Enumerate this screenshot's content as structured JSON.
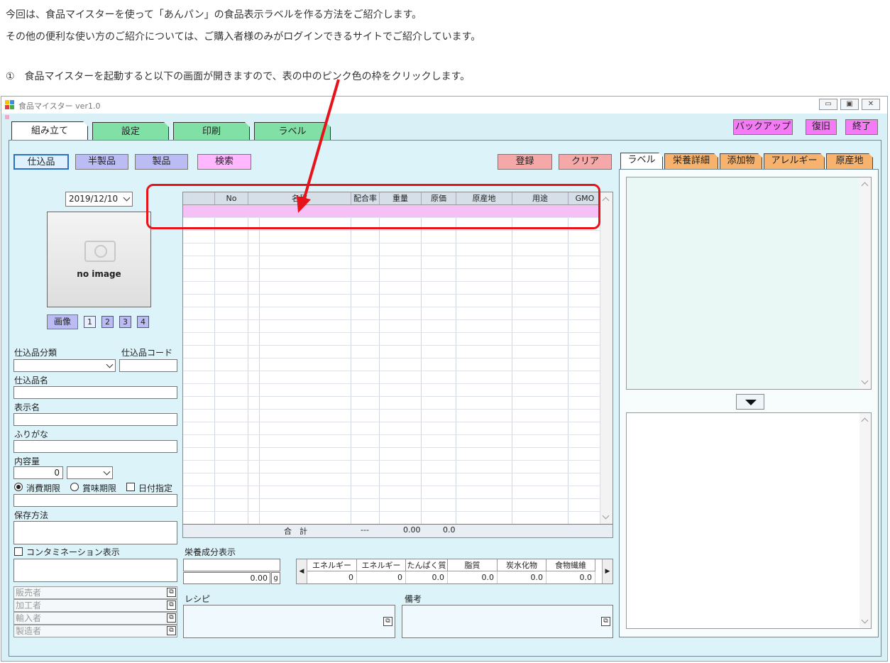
{
  "intro": {
    "line1": "今回は、食品マイスターを使って「あんパン」の食品表示ラベルを作る方法をご紹介します。",
    "line2": "その他の便利な使い方のご紹介については、ご購入者様のみがログインできるサイトでご紹介しています。",
    "step1": "①　食品マイスターを起動すると以下の画面が開きますので、表の中のピンク色の枠をクリックします。"
  },
  "window": {
    "title": "食品マイスター ver1.0",
    "minimize": "▭",
    "maximize": "▣",
    "close": "✕"
  },
  "main_tabs": [
    "組み立て",
    "設定",
    "印刷",
    "ラベル"
  ],
  "top_right_buttons": [
    "バックアップ",
    "復旧",
    "終了"
  ],
  "type_buttons": [
    "仕込品",
    "半製品",
    "製品",
    "検索"
  ],
  "action_buttons": {
    "register": "登録",
    "clear": "クリア"
  },
  "date": "2019/12/10",
  "image": {
    "placeholder": "no image",
    "button": "画像",
    "pages": [
      "1",
      "2",
      "3",
      "4"
    ]
  },
  "form": {
    "category_label": "仕込品分類",
    "code_label": "仕込品コード",
    "name_label": "仕込品名",
    "display_label": "表示名",
    "furigana_label": "ふりがな",
    "content_label": "内容量",
    "content_value": "0",
    "expiry1": "消費期限",
    "expiry2": "賞味期限",
    "date_spec": "日付指定",
    "storage_label": "保存方法",
    "contamination": "コンタミネーション表示",
    "makers": [
      "販売者",
      "加工者",
      "輸入者",
      "製造者"
    ]
  },
  "grid": {
    "columns": [
      "No",
      "名称",
      "配合率",
      "重量",
      "原価",
      "原産地",
      "用途",
      "GMO"
    ],
    "footer": {
      "total": "合　計",
      "ratio": "---",
      "weight": "0.00",
      "cost": "0.0"
    }
  },
  "nutrition": {
    "label": "栄養成分表示",
    "value": "0.00",
    "unit": "g",
    "columns": [
      "エネルギー",
      "エネルギー",
      "たんぱく質",
      "脂質",
      "炭水化物",
      "食物繊維"
    ],
    "values": [
      "0",
      "0",
      "0.0",
      "0.0",
      "0.0",
      "0.0"
    ]
  },
  "recipe_label": "レシピ",
  "notes_label": "備考",
  "right_tabs": [
    "ラベル",
    "栄養詳細",
    "添加物",
    "アレルギー",
    "原産地"
  ],
  "colors": {
    "highlight": "#f5c0f5",
    "annotation": "#e8121b"
  }
}
